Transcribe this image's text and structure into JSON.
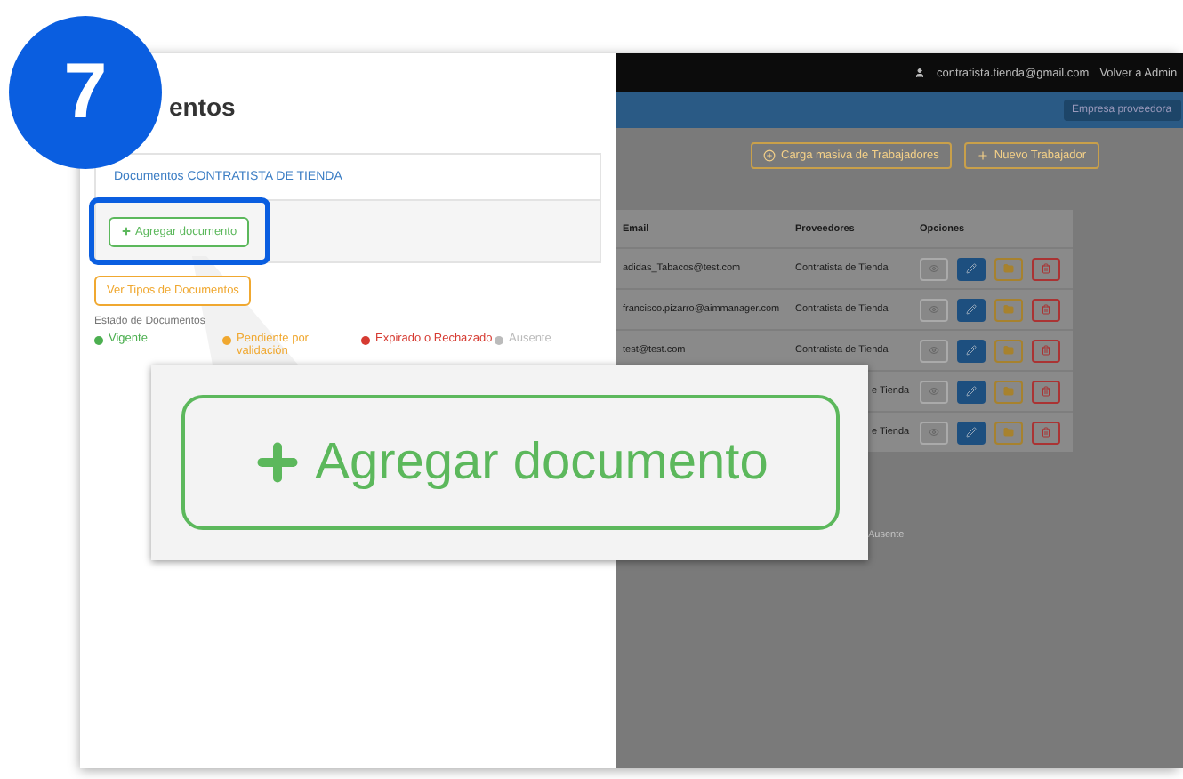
{
  "step_badge": "7",
  "modal": {
    "title": "entos",
    "card_title": "Documentos CONTRATISTA DE TIENDA",
    "add_button": "Agregar documento",
    "types_button": "Ver Tipos de Documentos",
    "legend_title": "Estado de Documentos",
    "legend": [
      {
        "label": "Vigente",
        "color": "#4caf50"
      },
      {
        "label": "Pendiente por validación",
        "color": "#f0a830"
      },
      {
        "label": "Expirado o Rechazado",
        "color": "#d63b32"
      },
      {
        "label": "Ausente",
        "color": "#bbbbbb"
      }
    ]
  },
  "background": {
    "user": "contratista.tienda@gmail.com",
    "back_link": "Volver a Admin",
    "company_button": "Empresa proveedora",
    "actions": [
      {
        "label": "Carga masiva de Trabajadores",
        "kind": "upload"
      },
      {
        "label": "Nuevo Trabajador",
        "kind": "add"
      }
    ],
    "columns": [
      "Email",
      "Proveedores",
      "Opciones"
    ],
    "rows": [
      {
        "email": "adidas_Tabacos@test.com",
        "provider": "Contratista de Tienda"
      },
      {
        "email": "francisco.pizarro@aimmanager.com",
        "provider": "Contratista de Tienda"
      },
      {
        "email": "test@test.com",
        "provider": "Contratista de Tienda"
      },
      {
        "provider": "e Tienda"
      },
      {
        "provider": "e Tienda"
      }
    ],
    "faint_text": "Ausente"
  },
  "callout": {
    "label": "Agregar documento"
  }
}
